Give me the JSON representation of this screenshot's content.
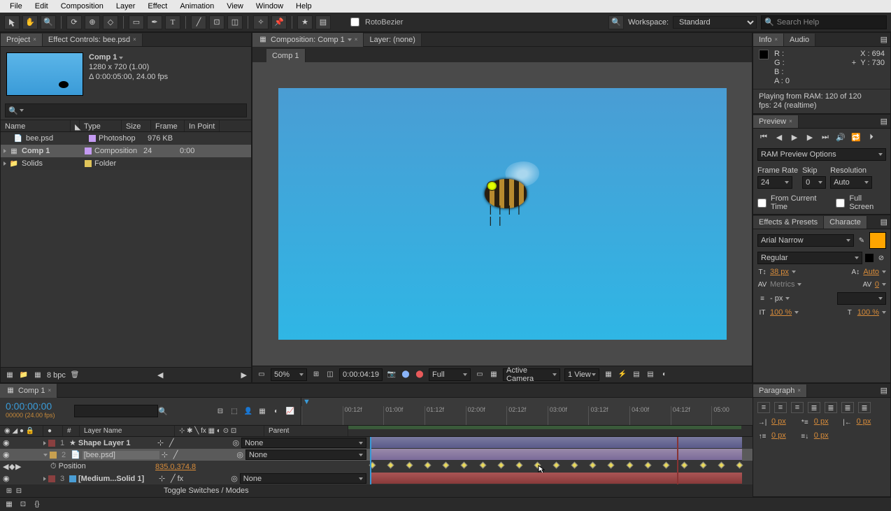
{
  "menu": [
    "File",
    "Edit",
    "Composition",
    "Layer",
    "Effect",
    "Animation",
    "View",
    "Window",
    "Help"
  ],
  "toolbar": {
    "rotobezier_label": "RotoBezier",
    "workspace_label": "Workspace:",
    "workspace_value": "Standard",
    "search_placeholder": "Search Help"
  },
  "project": {
    "tab_project": "Project",
    "tab_effect_controls": "Effect Controls: bee.psd",
    "comp_name": "Comp 1",
    "comp_dims": "1280 x 720 (1.00)",
    "comp_duration": "Δ 0:00:05:00, 24.00 fps",
    "cols": {
      "name": "Name",
      "type": "Type",
      "size": "Size",
      "frame": "Frame ...",
      "inpoint": "In Point"
    },
    "rows": [
      {
        "name": "bee.psd",
        "type": "Photoshop",
        "size": "976 KB",
        "color": "#c49af2"
      },
      {
        "name": "Comp 1",
        "type": "Composition",
        "size": "24",
        "in": "0:00",
        "color": "#c49af2",
        "active": true
      },
      {
        "name": "Solids",
        "type": "Folder",
        "size": "",
        "color": "#e0c45a"
      }
    ],
    "footer_bpc": "8 bpc"
  },
  "comp": {
    "tab_composition": "Composition: Comp 1",
    "tab_layer": "Layer: (none)",
    "mini_tab": "Comp 1",
    "footer": {
      "zoom": "50%",
      "timecode": "0:00:04:19",
      "resolution": "Full",
      "camera": "Active Camera",
      "views": "1 View"
    }
  },
  "info": {
    "tab_info": "Info",
    "tab_audio": "Audio",
    "r": "R :",
    "g": "G :",
    "b": "B :",
    "a": "A : 0",
    "x": "X : 694",
    "y": "Y : 730",
    "msg1": "Playing from RAM: 120 of 120",
    "msg2": "fps: 24 (realtime)"
  },
  "preview": {
    "tab": "Preview",
    "ram_label": "RAM Preview Options",
    "framerate_label": "Frame Rate",
    "framerate": "24",
    "skip_label": "Skip",
    "skip": "0",
    "resolution_label": "Resolution",
    "resolution": "Auto",
    "from_current": "From Current Time",
    "full_screen": "Full Screen"
  },
  "effects": {
    "tab_effects": "Effects & Presets",
    "tab_character": "Characte"
  },
  "character": {
    "font": "Arial Narrow",
    "style": "Regular",
    "size": "38 px",
    "leading": "Auto",
    "tracking": "Metrics",
    "kerning": "0",
    "px": "- px",
    "hscale": "100 %",
    "vscale": "100 %"
  },
  "paragraph": {
    "tab": "Paragraph",
    "px": "0 px"
  },
  "timeline": {
    "tab": "Comp 1",
    "timecode": "0:00:00:00",
    "sub": "00000 (24.00 fps)",
    "ruler": [
      "00:12f",
      "01:00f",
      "01:12f",
      "02:00f",
      "02:12f",
      "03:00f",
      "03:12f",
      "04:00f",
      "04:12f",
      "05:00"
    ],
    "cols": {
      "src": "#",
      "layer": "Layer Name",
      "parent": "Parent"
    },
    "layers": [
      {
        "idx": "1",
        "name": "Shape Layer 1",
        "color": "#8a4040",
        "type": "shape",
        "parent": "None",
        "bar": "blue"
      },
      {
        "idx": "2",
        "name": "[bee.psd]",
        "color": "#c8a050",
        "type": "psd",
        "parent": "None",
        "bar": "purple",
        "selected": true
      },
      {
        "idx": "3",
        "name": "[Medium...Solid 1]",
        "color": "#8a4040",
        "type": "solid",
        "parent": "None",
        "bar": "red"
      }
    ],
    "position_label": "Position",
    "position_value": "835.0,374.8",
    "footer": "Toggle Switches / Modes"
  }
}
